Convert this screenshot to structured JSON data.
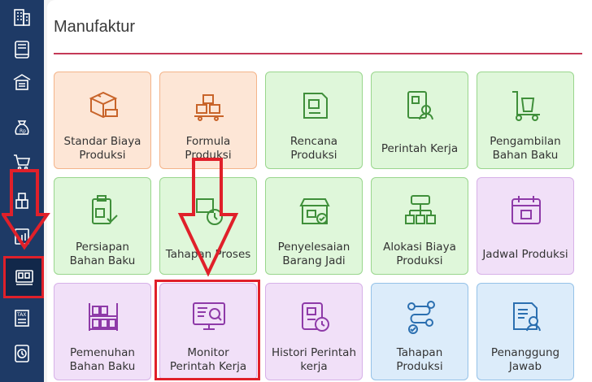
{
  "page": {
    "title": "Manufaktur"
  },
  "sidebar": {
    "items": [
      {
        "name": "building-icon",
        "active": false
      },
      {
        "name": "book-icon",
        "active": false
      },
      {
        "name": "warehouse-icon",
        "active": false
      },
      {
        "name": "money-bag-icon",
        "active": false
      },
      {
        "name": "cart-icon",
        "active": false
      },
      {
        "name": "box-stack-icon",
        "active": false
      },
      {
        "name": "report-icon",
        "active": false
      },
      {
        "name": "factory-monitor-icon",
        "active": true
      },
      {
        "name": "tax-icon",
        "active": false
      },
      {
        "name": "gear-clock-icon",
        "active": false
      }
    ]
  },
  "tiles": [
    {
      "label": "Standar Biaya\nProduksi",
      "icon": "cost-box-icon",
      "color": "orange"
    },
    {
      "label": "Formula\nProduksi",
      "icon": "formula-boxes-icon",
      "color": "orange"
    },
    {
      "label": "Rencana\nProduksi",
      "icon": "plan-note-icon",
      "color": "green"
    },
    {
      "label": "Perintah Kerja",
      "icon": "work-order-icon",
      "color": "green"
    },
    {
      "label": "Pengambilan\nBahan Baku",
      "icon": "trolley-icon",
      "color": "green"
    },
    {
      "label": "Persiapan\nBahan Baku",
      "icon": "clipboard-check-icon",
      "color": "green"
    },
    {
      "label": "Tahapan Proses",
      "icon": "process-clock-icon",
      "color": "green"
    },
    {
      "label": "Penyelesaian\nBarang Jadi",
      "icon": "store-check-icon",
      "color": "green"
    },
    {
      "label": "Alokasi Biaya\nProduksi",
      "icon": "cost-allocation-icon",
      "color": "green"
    },
    {
      "label": "Jadwal Produksi",
      "icon": "calendar-icon",
      "color": "purple"
    },
    {
      "label": "Pemenuhan\nBahan Baku",
      "icon": "shelf-boxes-icon",
      "color": "purple"
    },
    {
      "label": "Monitor\nPerintah Kerja",
      "icon": "monitor-search-icon",
      "color": "purple"
    },
    {
      "label": "Histori Perintah\nkerja",
      "icon": "history-badge-icon",
      "color": "purple"
    },
    {
      "label": "Tahapan\nProduksi",
      "icon": "workflow-icon",
      "color": "blue"
    },
    {
      "label": "Penanggung\nJawab",
      "icon": "responsible-person-icon",
      "color": "blue"
    }
  ],
  "colors": {
    "sidebar": "#1e3a66",
    "accent_rule": "#c43a57",
    "annotation": "#e0202a"
  }
}
